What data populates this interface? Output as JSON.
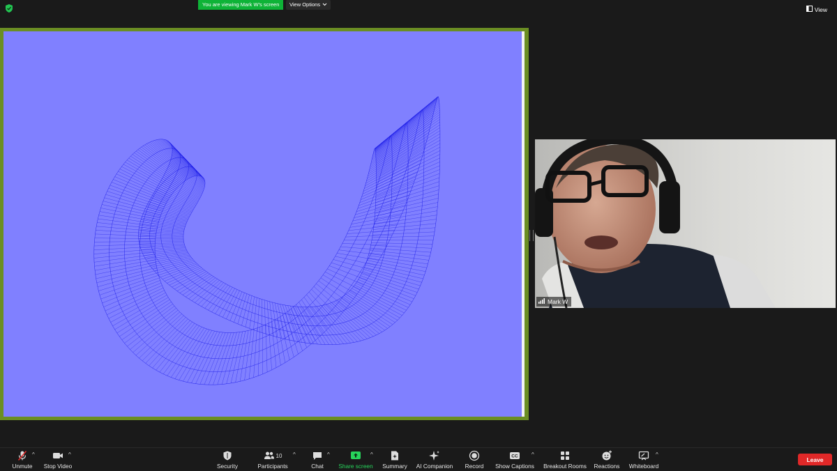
{
  "top_bar": {
    "viewing_label": "You are viewing Mark W's screen",
    "view_options_label": "View Options",
    "view_label": "View",
    "security_status_icon": "green-shield-check-icon"
  },
  "shared_screen": {
    "owner": "Mark W",
    "border_color": "#6b8e23",
    "background_color": "#8080ff",
    "curve_color": "#1010e6"
  },
  "participant_video": {
    "name": "Mark W",
    "signal_icon": "signal-bars-icon"
  },
  "toolbar": {
    "unmute_label": "Unmute",
    "stop_video_label": "Stop Video",
    "security_label": "Security",
    "participants_label": "Participants",
    "participants_count": "10",
    "chat_label": "Chat",
    "share_screen_label": "Share screen",
    "summary_label": "Summary",
    "ai_companion_label": "AI Companion",
    "record_label": "Record",
    "show_captions_label": "Show Captions",
    "captions_icon_text": "CC",
    "breakout_rooms_label": "Breakout Rooms",
    "reactions_label": "Reactions",
    "whiteboard_label": "Whiteboard",
    "leave_label": "Leave",
    "accent_green": "#27d35b",
    "leave_color": "#e02828"
  }
}
